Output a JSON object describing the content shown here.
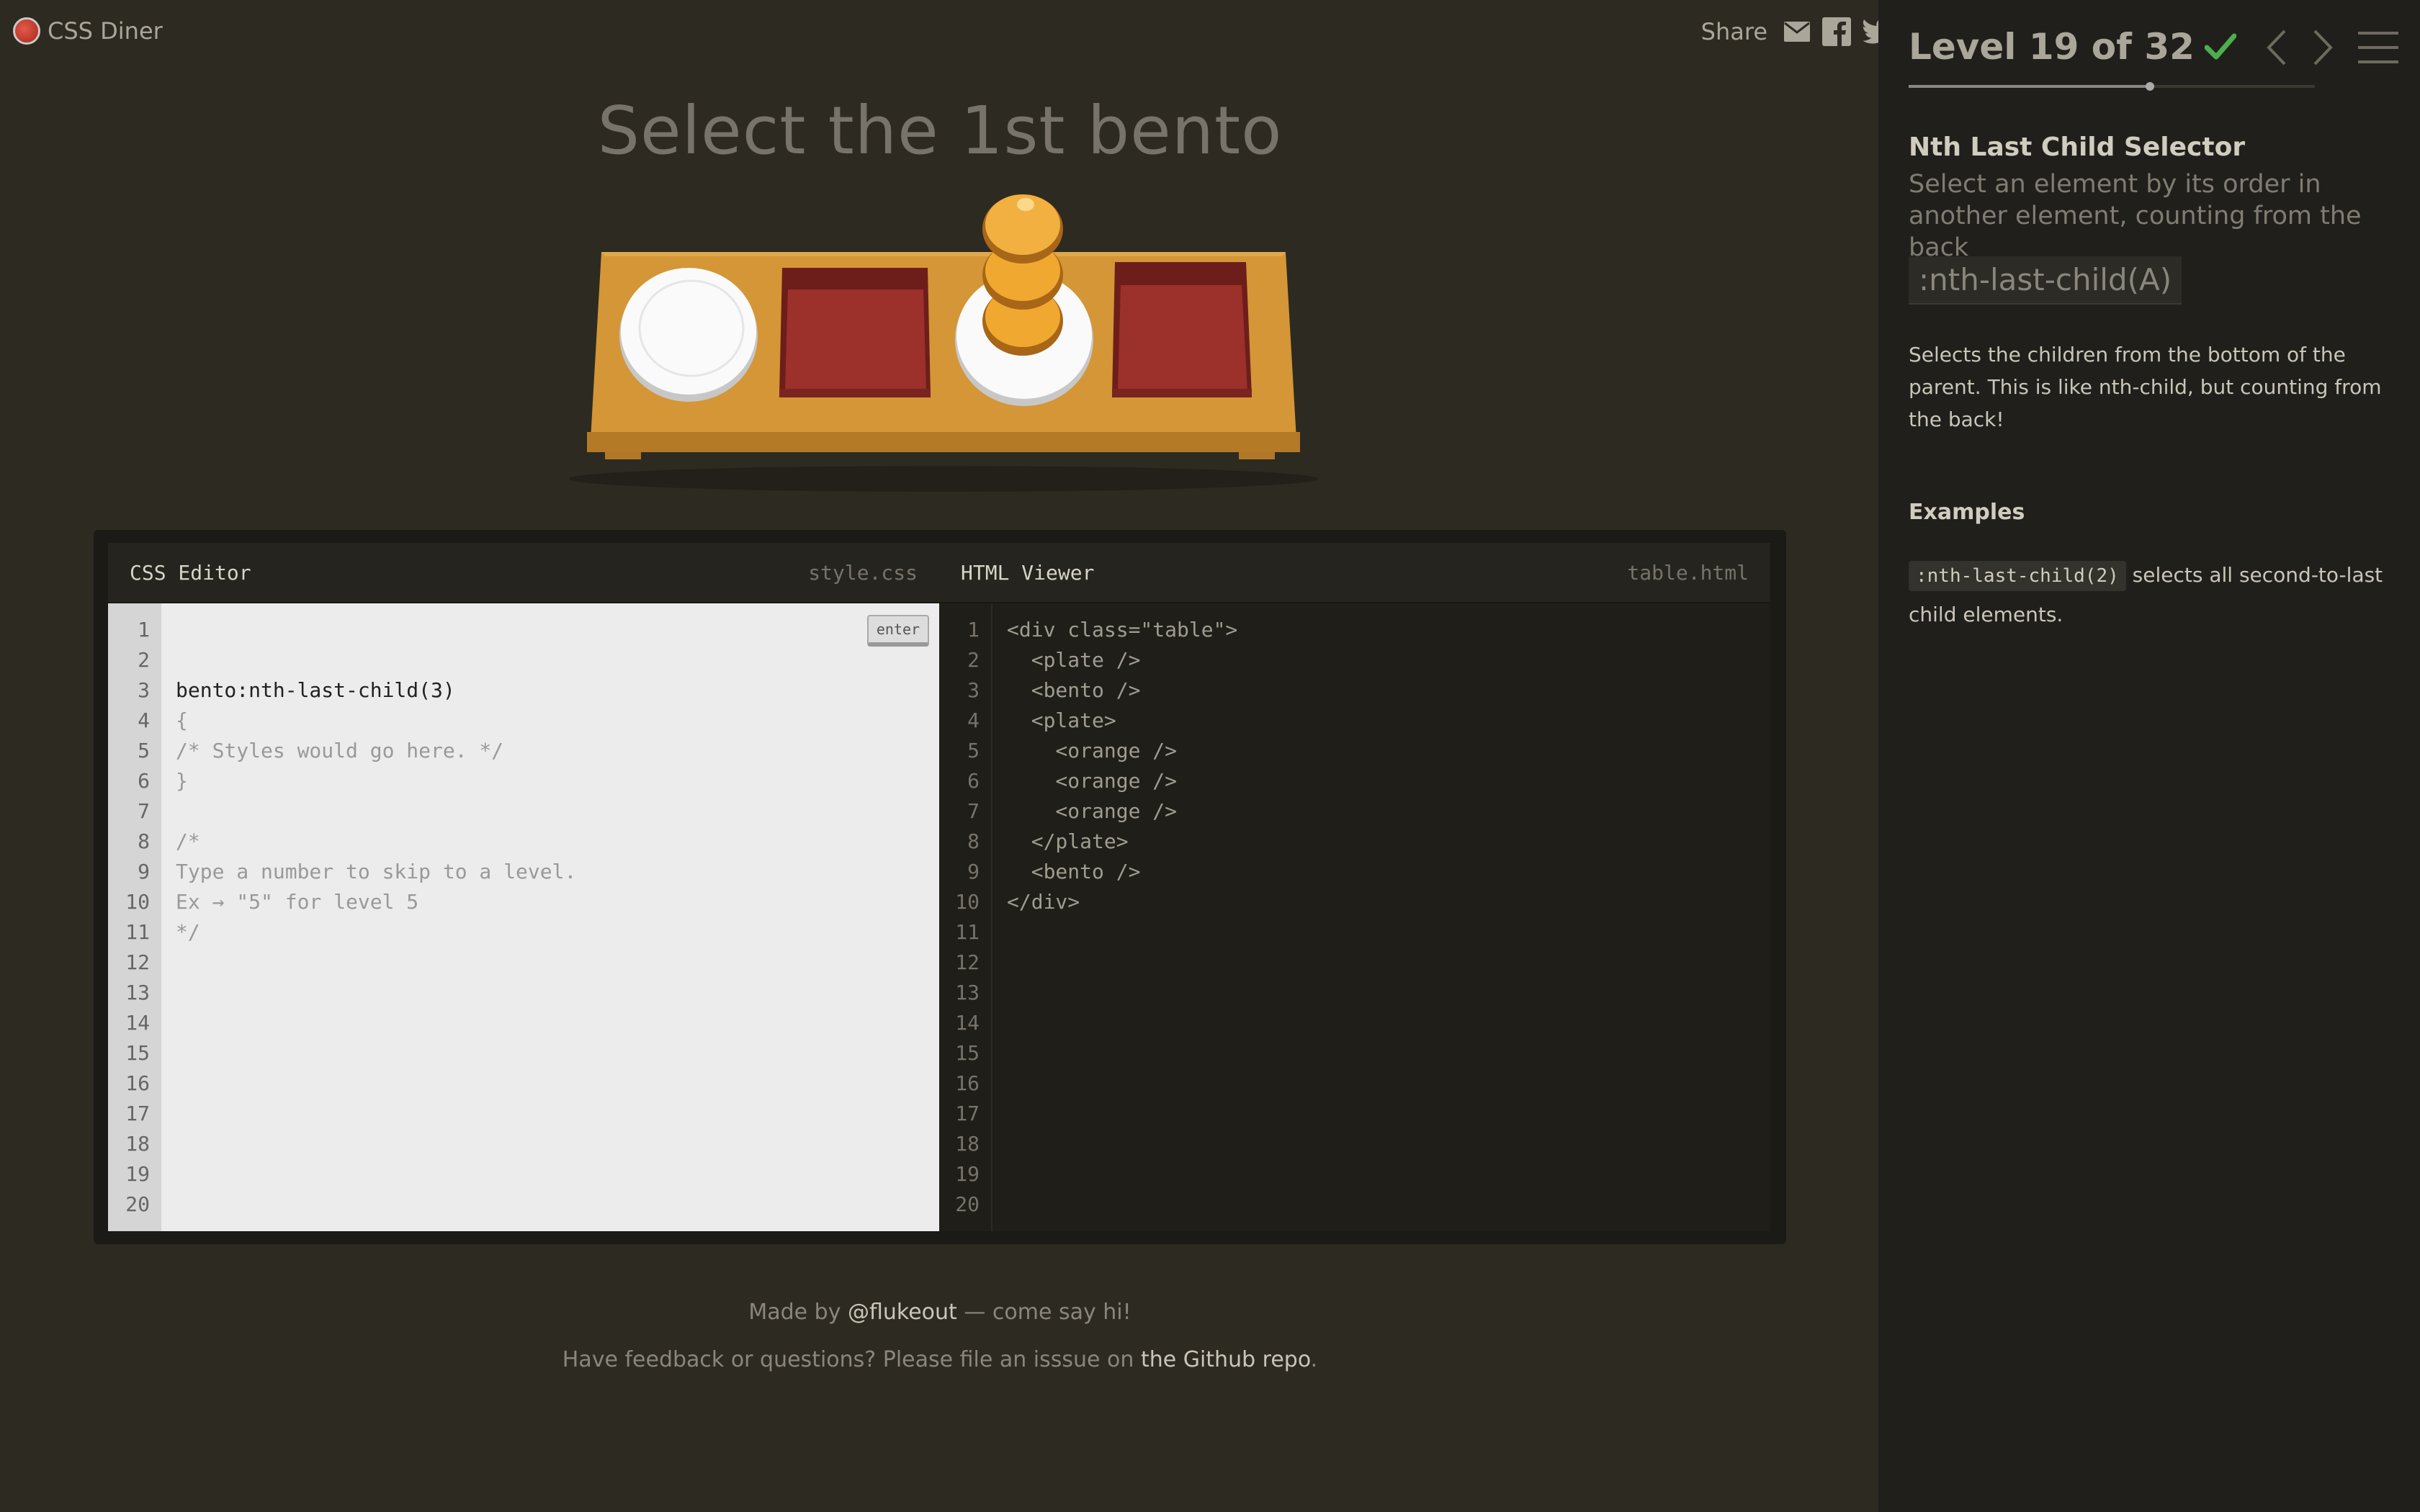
{
  "app": {
    "name": "CSS Diner"
  },
  "share": {
    "label": "Share",
    "icons": [
      "mail-icon",
      "facebook-icon",
      "twitter-icon"
    ]
  },
  "level": {
    "instruction": "Select the 1st bento",
    "title": "Level 19 of 32",
    "current": 19,
    "total": 32,
    "completed": true
  },
  "editor": {
    "css": {
      "title": "CSS Editor",
      "file": "style.css",
      "input_value": "bento:nth-last-child(3)",
      "lines": [
        "",
        "{",
        "/* Styles would go here. */",
        "}",
        "",
        "/*",
        "Type a number to skip to a level.",
        "Ex → \"5\" for level 5",
        "*/"
      ],
      "enter_label": "enter",
      "line_count": 20
    },
    "html": {
      "title": "HTML Viewer",
      "file": "table.html",
      "lines": [
        "<div class=\"table\">",
        "  <plate />",
        "  <bento />",
        "  <plate>",
        "    <orange />",
        "    <orange />",
        "    <orange />",
        "  </plate>",
        "  <bento />",
        "</div>"
      ],
      "line_count": 20
    }
  },
  "footer": {
    "line1_prefix": "Made by ",
    "line1_link": "@flukeout",
    "line1_suffix": " — come say hi!",
    "line2_prefix": "Have feedback or questions? Please file an isssue on ",
    "line2_link": "the Github repo",
    "line2_suffix": "."
  },
  "sidebar": {
    "selector_name": "Nth Last Child Selector",
    "selector_desc": "Select an element by its order in another element, counting from the back",
    "syntax": ":nth-last-child(A)",
    "help": "Selects the children from the bottom of the parent. This is like nth-child, but counting from the back!",
    "examples_title": "Examples",
    "example_code": ":nth-last-child(2)",
    "example_text": " selects all second-to-last child elements."
  },
  "colors": {
    "background": "#2d2a22",
    "sidebar": "#211f1b",
    "table": "#d89a3c",
    "bento": "#8e2a26",
    "orange": "#f0a830",
    "check": "#4cae4c"
  }
}
